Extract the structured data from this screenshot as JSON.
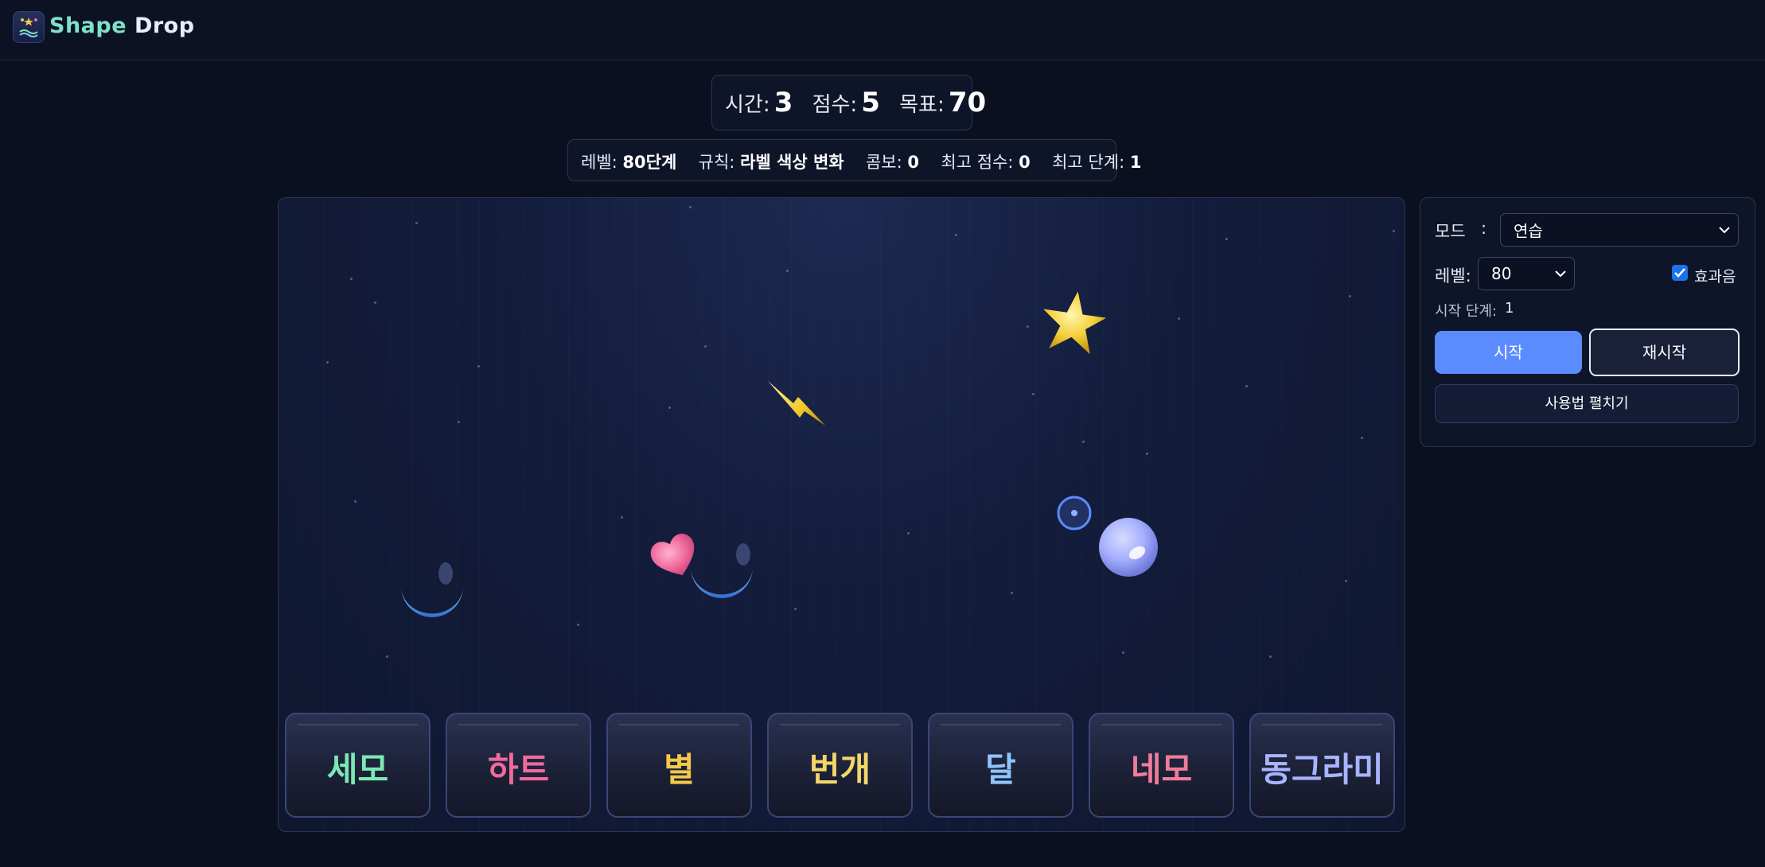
{
  "app": {
    "title_part1": "Shape",
    "title_part2": "Drop"
  },
  "hud": {
    "time_label": "시간:",
    "time_value": "3",
    "score_label": "점수:",
    "score_value": "5",
    "goal_label": "목표:",
    "goal_value": "70"
  },
  "info": {
    "level_label": "레벨:",
    "level_value": "80단계",
    "rule_label": "규칙:",
    "rule_value": "라벨 색상 변화",
    "combo_label": "콤보:",
    "combo_value": "0",
    "best_score_label": "최고 점수:",
    "best_score_value": "0",
    "best_level_label": "최고 단계:",
    "best_level_value": "1"
  },
  "game": {
    "falling_shapes": [
      "star-shape",
      "lightning-shape",
      "heart-shape",
      "moon-shape",
      "moon-shape",
      "circle-shape"
    ],
    "slots": [
      {
        "label": "세모",
        "color": "#7ce8b4"
      },
      {
        "label": "하트",
        "color": "#f06a9c"
      },
      {
        "label": "별",
        "color": "#f5c84a"
      },
      {
        "label": "번개",
        "color": "#f3d76a"
      },
      {
        "label": "달",
        "color": "#8fc4ff"
      },
      {
        "label": "네모",
        "color": "#f07c9a"
      },
      {
        "label": "동그라미",
        "color": "#a8b4ff"
      }
    ]
  },
  "controls": {
    "mode_label": "모드",
    "mode_colon": ":",
    "mode_value": "연습",
    "level_label": "레벨:",
    "level_value": "80",
    "sfx_label": "효과음",
    "sfx_checked": true,
    "start_level_label": "시작 단계:",
    "start_level_value": "1",
    "start_button": "시작",
    "restart_button": "재시작",
    "help_button": "사용법 펼치기"
  },
  "colors": {
    "accent": "#5b8cff",
    "background": "#0b1020"
  }
}
